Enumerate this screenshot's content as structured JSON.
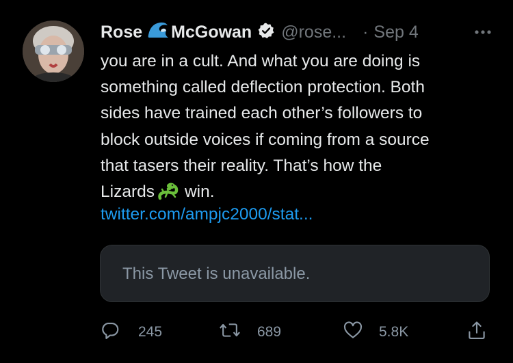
{
  "tweet": {
    "author_name_part1": "Rose",
    "author_name_part2": "McGowan",
    "handle": "@rose...",
    "separator": "·",
    "date": "Sep 4",
    "lines": [
      "you are in a cult. And what you are doing is",
      "something called deflection protection. Both",
      "sides have trained each other’s followers to",
      "block outside voices if coming from a source",
      "that tasers their reality. That’s how the"
    ],
    "last_line_before": "Lizards",
    "last_line_after": "win.",
    "link": "twitter.com/ampjc2000/stat...",
    "quote_unavailable": "This Tweet is unavailable."
  },
  "actions": {
    "replies": "245",
    "retweets": "689",
    "likes": "5.8K"
  },
  "icons": {
    "wave": "water-wave-icon",
    "verified": "verified-badge-icon",
    "more": "more-options-icon",
    "lizard": "lizard-emoji-icon",
    "reply": "reply-icon",
    "retweet": "retweet-icon",
    "like": "heart-icon",
    "share": "share-icon"
  },
  "colors": {
    "background": "#000000",
    "text": "#e7e9ea",
    "muted": "#71767b",
    "link": "#1d9bf0",
    "quote_bg": "#202327"
  }
}
